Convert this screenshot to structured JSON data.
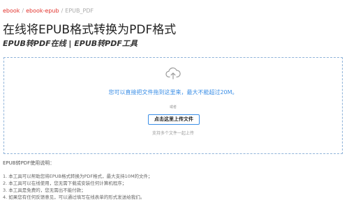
{
  "breadcrumb": {
    "items": [
      {
        "label": "ebook"
      },
      {
        "label": "ebook-epub"
      },
      {
        "label": "EPUB_PDF"
      }
    ],
    "separator": "/"
  },
  "page": {
    "title": "在线将EPUB格式转换为PDF格式",
    "subtitle": "EPUB转PDF在线 | EPUB转PDF工具"
  },
  "upload": {
    "icon": "cloud-upload-icon",
    "drop_hint": "您可以直接把文件拖到这里来，最大不能超过20M。",
    "or_text": "或者",
    "button_label": "点击这里上传文件",
    "multi_hint": "支持多个文件一起上传"
  },
  "instructions": {
    "title": "EPUB转PDF使用说明：",
    "items": [
      "1. 本工具可以帮助您将EPUB格式转换为PDF格式，最大支持10M的文件；",
      "2. 本工具可以在线使用，您无需下载或安装任何计算机程序；",
      "3. 本工具是免费的，您无需出不能付款；",
      "4. 如果您有任何反馈意见，可以通过填写在线表单的形式发送给我们。"
    ]
  },
  "colors": {
    "link": "#e2322c",
    "accent": "#3a8ee6",
    "dashed_border": "#8fb3d9"
  }
}
